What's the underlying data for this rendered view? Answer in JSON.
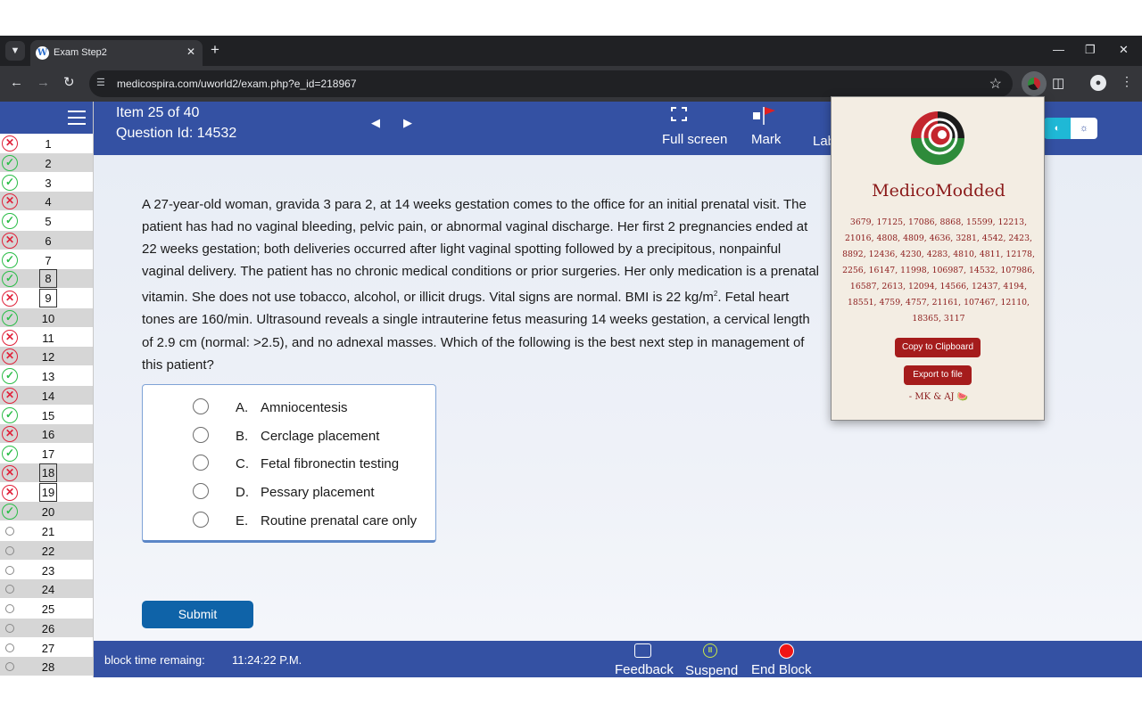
{
  "browser": {
    "tab": {
      "title": "Exam Step2",
      "favicon": "W"
    },
    "url": "medicospira.com/uworld2/exam.php?e_id=218967"
  },
  "exam": {
    "item": "Item 25 of 40",
    "question_id": "Question Id: 14532",
    "toolbar": {
      "fullscreen_label": "Full screen",
      "mark_label": "Mark",
      "lab_label": "Lab"
    }
  },
  "question_list": [
    {
      "num": "1",
      "status": "wrong",
      "boxed": false
    },
    {
      "num": "2",
      "status": "correct",
      "boxed": false
    },
    {
      "num": "3",
      "status": "correct",
      "boxed": false
    },
    {
      "num": "4",
      "status": "wrong",
      "boxed": false
    },
    {
      "num": "5",
      "status": "correct",
      "boxed": false
    },
    {
      "num": "6",
      "status": "wrong",
      "boxed": false
    },
    {
      "num": "7",
      "status": "correct",
      "boxed": false
    },
    {
      "num": "8",
      "status": "correct",
      "boxed": true
    },
    {
      "num": "9",
      "status": "wrong",
      "boxed": true
    },
    {
      "num": "10",
      "status": "correct",
      "boxed": false
    },
    {
      "num": "11",
      "status": "wrong",
      "boxed": false
    },
    {
      "num": "12",
      "status": "wrong",
      "boxed": false
    },
    {
      "num": "13",
      "status": "correct",
      "boxed": false
    },
    {
      "num": "14",
      "status": "wrong",
      "boxed": false
    },
    {
      "num": "15",
      "status": "correct",
      "boxed": false
    },
    {
      "num": "16",
      "status": "wrong",
      "boxed": false
    },
    {
      "num": "17",
      "status": "correct",
      "boxed": false
    },
    {
      "num": "18",
      "status": "wrong",
      "boxed": true
    },
    {
      "num": "19",
      "status": "wrong",
      "boxed": true
    },
    {
      "num": "20",
      "status": "correct",
      "boxed": false
    },
    {
      "num": "21",
      "status": "unanswered",
      "boxed": false
    },
    {
      "num": "22",
      "status": "unanswered",
      "boxed": false
    },
    {
      "num": "23",
      "status": "unanswered",
      "boxed": false
    },
    {
      "num": "24",
      "status": "unanswered",
      "boxed": false
    },
    {
      "num": "25",
      "status": "unanswered",
      "boxed": false
    },
    {
      "num": "26",
      "status": "unanswered",
      "boxed": false
    },
    {
      "num": "27",
      "status": "unanswered",
      "boxed": false
    },
    {
      "num": "28",
      "status": "unanswered",
      "boxed": false
    }
  ],
  "question": {
    "stem_parts": {
      "before_sup": "A 27-year-old woman, gravida 3 para 2, at 14 weeks gestation comes to the office for an initial prenatal visit.  The patient has had no vaginal bleeding, pelvic pain, or abnormal vaginal discharge.  Her first 2 pregnancies ended at 22 weeks gestation; both deliveries occurred after light vaginal spotting followed by a precipitous, nonpainful vaginal delivery.  The patient has no chronic medical conditions or prior surgeries.  Her only medication is a prenatal vitamin.  She does not use tobacco, alcohol, or illicit drugs.  Vital signs are normal.  BMI is 22 kg/m",
      "sup": "2",
      "after_sup": ".  Fetal heart tones are 160/min.  Ultrasound reveals a single intrauterine fetus measuring 14 weeks gestation, a cervical length of 2.9 cm (normal: >2.5), and no adnexal masses.  Which of the following is the best next step in management of this patient?"
    },
    "choices": [
      {
        "letter": "A.",
        "text": "Amniocentesis"
      },
      {
        "letter": "B.",
        "text": "Cerclage placement"
      },
      {
        "letter": "C.",
        "text": "Fetal fibronectin testing"
      },
      {
        "letter": "D.",
        "text": "Pessary placement"
      },
      {
        "letter": "E.",
        "text": "Routine prenatal care only"
      }
    ],
    "submit_label": "Submit"
  },
  "footer": {
    "time_label": "block time remaing:",
    "time_value": "11:24:22 P.M.",
    "feedback_label": "Feedback",
    "suspend_label": "Suspend",
    "end_label": "End Block"
  },
  "popup": {
    "title": "MedicoModded",
    "id_list": "3679, 17125, 17086, 8868, 15599, 12213, 21016, 4808, 4809, 4636, 3281, 4542, 2423, 8892, 12436, 4230, 4283, 4810, 4811, 12178, 2256, 16147, 11998, 106987, 14532, 107986, 16587, 2613, 12094, 14566, 12437, 4194, 18551, 4759, 4757, 21161, 107467, 12110, 18365, 3117",
    "copy_label": "Copy to Clipboard",
    "export_label": "Export to file",
    "signature": "- MK & AJ 🍉"
  },
  "colors": {
    "brand_blue": "#3451a3",
    "correct": "#2bbd48",
    "wrong": "#e0223a",
    "popup_accent": "#a51c1c",
    "submit": "#0f63a8"
  },
  "icons": {
    "fullscreen": "fullscreen-icon",
    "mark": "flag-icon",
    "feedback": "speech-bubble-icon",
    "suspend": "pause-icon",
    "end_block": "red-circle-icon"
  }
}
